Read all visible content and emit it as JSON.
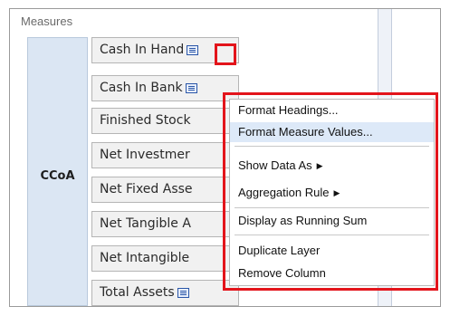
{
  "header": {
    "label": "Measures"
  },
  "group": {
    "label": "CCoA"
  },
  "rows": [
    {
      "label": "Cash In Hand",
      "has_icon": true
    },
    {
      "label": "Cash In Bank",
      "has_icon": true
    },
    {
      "label": "Finished Stock"
    },
    {
      "label": "Net Investmer"
    },
    {
      "label": "Net Fixed Asse"
    },
    {
      "label": "Net Tangible A"
    },
    {
      "label": "Net Intangible"
    },
    {
      "label": "Total Assets",
      "has_icon": true
    }
  ],
  "context_menu": {
    "items": [
      {
        "label": "Format Headings..."
      },
      {
        "label": "Format Measure Values...",
        "active": true
      },
      {
        "label": "Show Data As",
        "submenu": true
      },
      {
        "label": "Aggregation Rule",
        "submenu": true
      },
      {
        "label": "Display as Running Sum"
      },
      {
        "label": "Duplicate Layer"
      },
      {
        "label": "Remove Column"
      }
    ],
    "submenu_arrow": "▶"
  },
  "colors": {
    "highlight": "#e3141b",
    "active_item_bg": "#dde9f8",
    "group_bg": "#dbe6f3"
  }
}
